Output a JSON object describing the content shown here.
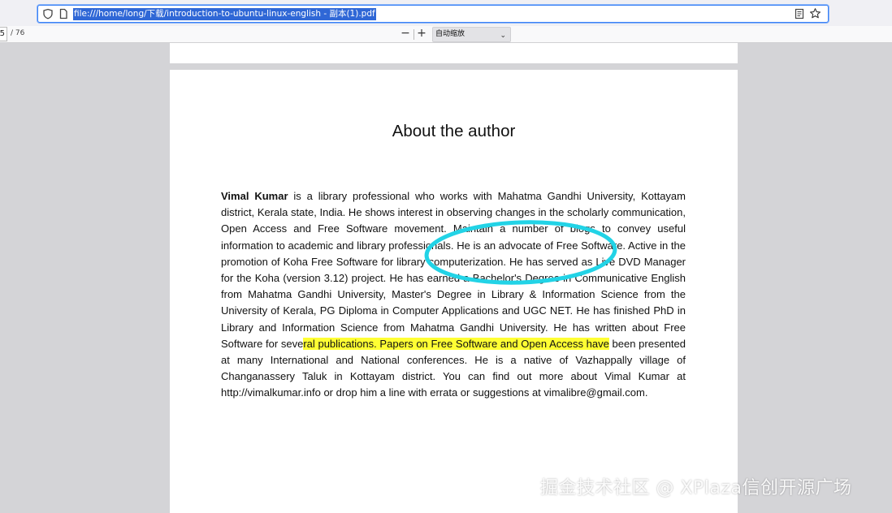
{
  "browser": {
    "url": "file:///home/long/下载/introduction-to-ubuntu-linux-english - 副本(1).pdf"
  },
  "toolbar": {
    "page_current": "5",
    "page_total": "/ 76",
    "zoom_out": "−",
    "zoom_in": "+",
    "zoom_value": "自动缩放"
  },
  "document": {
    "title": "About the author",
    "author_name": "Vimal Kumar",
    "para_part1": " is a library professional who works with Mahatma Gandhi University, Kottayam district, Kerala state, India. He shows interest in observing changes in the scholarly communication, Open Access and Free Software movement. Maintain a number of blogs to convey useful information to academic and library professionals. He is an advocate of Free Software. Active in the promotion of Koha Free Software for library computerization. He has served as Live DVD Manager for the Koha (version 3.12) project. He has earned a Bachelor's Degree in Communicative English from Mahatma Gandhi University, Master's Degree in Library & Information Science from the University of Kerala, PG Diploma in Computer Applications and UGC NET. He has finished PhD in Library and Information Science from Mahatma Gandhi University. He has written about Free Software for seve",
    "para_highlight": "ral publications. Papers on Free Software and Open Access have",
    "para_part2": " been presented at many International and National conferences. He is a native of Vazhappally village of Changanassery Taluk in Kottayam district. You can find out more about Vimal Kumar at http://vimalkumar.info or drop him a line with errata or suggestions at vimalibre@gmail.com."
  },
  "annotation": {
    "color": "#22d3e6"
  },
  "highlight_color": "#ffff33",
  "watermark": "掘金技术社区 @ XPlaza信创开源广场"
}
